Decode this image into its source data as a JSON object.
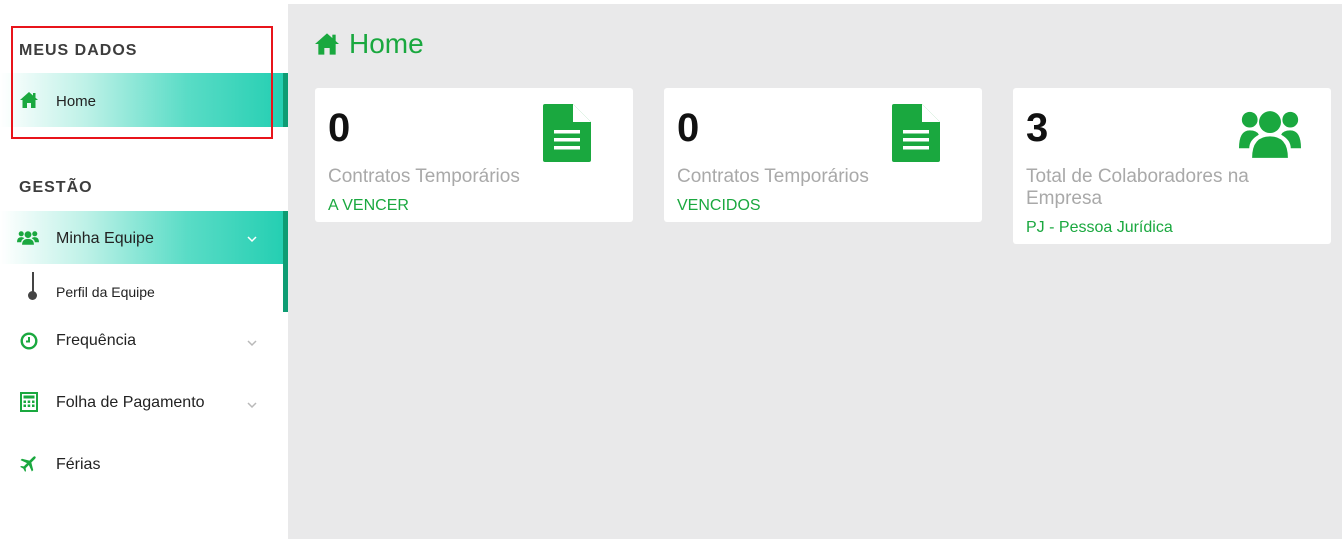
{
  "sidebar": {
    "section1": "MEUS DADOS",
    "home_label": "Home",
    "section2": "GESTÃO",
    "team_label": "Minha Equipe",
    "team_sub": "Perfil da Equipe",
    "freq_label": "Frequência",
    "payroll_label": "Folha de Pagamento",
    "vacation_label": "Férias"
  },
  "main": {
    "title": "Home",
    "cards": [
      {
        "value": "0",
        "desc": "Contratos Temporários",
        "link": "A VENCER",
        "icon": "document-icon"
      },
      {
        "value": "0",
        "desc": "Contratos Temporários",
        "link": "VENCIDOS",
        "icon": "document-icon"
      },
      {
        "value": "3",
        "desc": "Total de Colaboradores na Empresa",
        "link": "PJ - Pessoa Jurídica",
        "icon": "users-icon"
      }
    ]
  },
  "colors": {
    "accent": "#1aa83f",
    "active_bar": "#0e9c73",
    "highlight": "#e8141b"
  }
}
